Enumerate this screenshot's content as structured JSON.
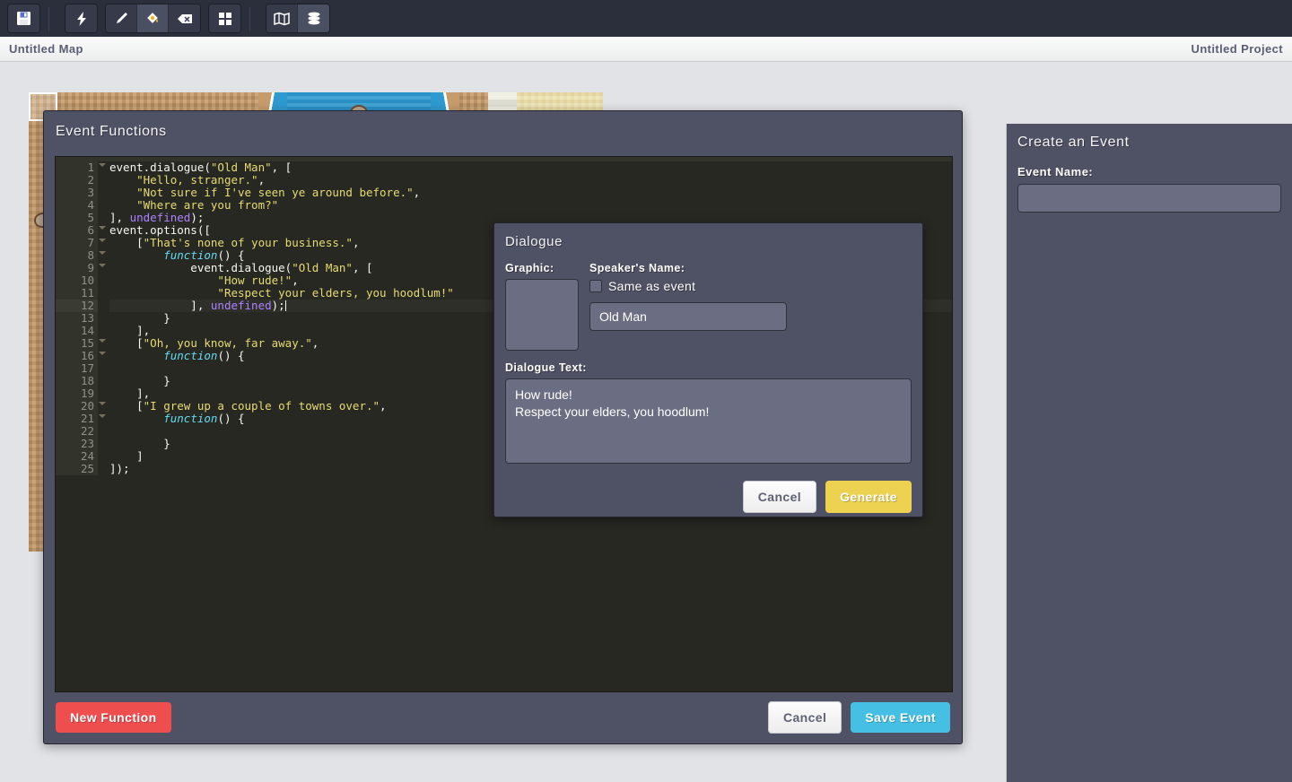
{
  "toolbar": {
    "groups": [
      {
        "name": "file",
        "buttons": [
          {
            "icon": "save-icon",
            "label": "Save",
            "active": false
          }
        ]
      },
      {
        "name": "tools-primary",
        "buttons": [
          {
            "icon": "lightning-icon",
            "label": "Events",
            "active": false
          }
        ]
      },
      {
        "name": "tools-draw",
        "buttons": [
          {
            "icon": "brush-icon",
            "label": "Brush",
            "active": false
          },
          {
            "icon": "bucket-icon",
            "label": "Fill Bucket",
            "active": true
          },
          {
            "icon": "eraser-icon",
            "label": "Eraser",
            "active": false
          }
        ]
      },
      {
        "name": "tools-grid",
        "buttons": [
          {
            "icon": "grid-icon",
            "label": "Grid",
            "active": false
          }
        ]
      },
      {
        "name": "views",
        "buttons": [
          {
            "icon": "map-icon",
            "label": "Map",
            "active": false
          },
          {
            "icon": "layers-icon",
            "label": "Layers",
            "active": true
          }
        ]
      }
    ]
  },
  "titlebar": {
    "map_title": "Untitled Map",
    "project_title": "Untitled Project"
  },
  "sidebar": {
    "heading": "Create an Event",
    "event_name_label": "Event Name:",
    "event_name_value": "",
    "event_name_placeholder": ""
  },
  "event_panel": {
    "heading": "Event Functions",
    "new_function_label": "New Function",
    "cancel_label": "Cancel",
    "save_label": "Save Event",
    "active_line": 12,
    "code_lines": [
      {
        "n": 1,
        "fold": true,
        "tokens": [
          {
            "t": "event.dialogue(",
            "c": "plain"
          },
          {
            "t": "\"Old Man\"",
            "c": "str"
          },
          {
            "t": ", [",
            "c": "plain"
          }
        ]
      },
      {
        "n": 2,
        "fold": false,
        "tokens": [
          {
            "t": "    ",
            "c": "plain"
          },
          {
            "t": "\"Hello, stranger.\"",
            "c": "str"
          },
          {
            "t": ",",
            "c": "plain"
          }
        ]
      },
      {
        "n": 3,
        "fold": false,
        "tokens": [
          {
            "t": "    ",
            "c": "plain"
          },
          {
            "t": "\"Not sure if I've seen ye around before.\"",
            "c": "str"
          },
          {
            "t": ",",
            "c": "plain"
          }
        ]
      },
      {
        "n": 4,
        "fold": false,
        "tokens": [
          {
            "t": "    ",
            "c": "plain"
          },
          {
            "t": "\"Where are you from?\"",
            "c": "str"
          }
        ]
      },
      {
        "n": 5,
        "fold": false,
        "tokens": [
          {
            "t": "], ",
            "c": "plain"
          },
          {
            "t": "undefined",
            "c": "undef"
          },
          {
            "t": ");",
            "c": "plain"
          }
        ]
      },
      {
        "n": 6,
        "fold": true,
        "tokens": [
          {
            "t": "event.options([",
            "c": "plain"
          }
        ]
      },
      {
        "n": 7,
        "fold": true,
        "tokens": [
          {
            "t": "    [",
            "c": "plain"
          },
          {
            "t": "\"That's none of your business.\"",
            "c": "str"
          },
          {
            "t": ",",
            "c": "plain"
          }
        ]
      },
      {
        "n": 8,
        "fold": true,
        "tokens": [
          {
            "t": "        ",
            "c": "plain"
          },
          {
            "t": "function",
            "c": "fn"
          },
          {
            "t": "() {",
            "c": "plain"
          }
        ]
      },
      {
        "n": 9,
        "fold": true,
        "tokens": [
          {
            "t": "            event.dialogue(",
            "c": "plain"
          },
          {
            "t": "\"Old Man\"",
            "c": "str"
          },
          {
            "t": ", [",
            "c": "plain"
          }
        ]
      },
      {
        "n": 10,
        "fold": false,
        "tokens": [
          {
            "t": "                ",
            "c": "plain"
          },
          {
            "t": "\"How rude!\"",
            "c": "str"
          },
          {
            "t": ",",
            "c": "plain"
          }
        ]
      },
      {
        "n": 11,
        "fold": false,
        "tokens": [
          {
            "t": "                ",
            "c": "plain"
          },
          {
            "t": "\"Respect your elders, you hoodlum!\"",
            "c": "str"
          }
        ]
      },
      {
        "n": 12,
        "fold": false,
        "caret": true,
        "tokens": [
          {
            "t": "            ], ",
            "c": "plain"
          },
          {
            "t": "undefined",
            "c": "undef"
          },
          {
            "t": ");",
            "c": "plain"
          }
        ]
      },
      {
        "n": 13,
        "fold": false,
        "tokens": [
          {
            "t": "        }",
            "c": "plain"
          }
        ]
      },
      {
        "n": 14,
        "fold": false,
        "tokens": [
          {
            "t": "    ],",
            "c": "plain"
          }
        ]
      },
      {
        "n": 15,
        "fold": true,
        "tokens": [
          {
            "t": "    [",
            "c": "plain"
          },
          {
            "t": "\"Oh, you know, far away.\"",
            "c": "str"
          },
          {
            "t": ",",
            "c": "plain"
          }
        ]
      },
      {
        "n": 16,
        "fold": true,
        "tokens": [
          {
            "t": "        ",
            "c": "plain"
          },
          {
            "t": "function",
            "c": "fn"
          },
          {
            "t": "() {",
            "c": "plain"
          }
        ]
      },
      {
        "n": 17,
        "fold": false,
        "tokens": [
          {
            "t": "",
            "c": "plain"
          }
        ]
      },
      {
        "n": 18,
        "fold": false,
        "tokens": [
          {
            "t": "        }",
            "c": "plain"
          }
        ]
      },
      {
        "n": 19,
        "fold": false,
        "tokens": [
          {
            "t": "    ],",
            "c": "plain"
          }
        ]
      },
      {
        "n": 20,
        "fold": true,
        "tokens": [
          {
            "t": "    [",
            "c": "plain"
          },
          {
            "t": "\"I grew up a couple of towns over.\"",
            "c": "str"
          },
          {
            "t": ",",
            "c": "plain"
          }
        ]
      },
      {
        "n": 21,
        "fold": true,
        "tokens": [
          {
            "t": "        ",
            "c": "plain"
          },
          {
            "t": "function",
            "c": "fn"
          },
          {
            "t": "() {",
            "c": "plain"
          }
        ]
      },
      {
        "n": 22,
        "fold": false,
        "tokens": [
          {
            "t": "",
            "c": "plain"
          }
        ]
      },
      {
        "n": 23,
        "fold": false,
        "tokens": [
          {
            "t": "        }",
            "c": "plain"
          }
        ]
      },
      {
        "n": 24,
        "fold": false,
        "tokens": [
          {
            "t": "    ]",
            "c": "plain"
          }
        ]
      },
      {
        "n": 25,
        "fold": false,
        "tokens": [
          {
            "t": "]);",
            "c": "plain"
          }
        ]
      }
    ]
  },
  "dialogue_modal": {
    "heading": "Dialogue",
    "graphic_label": "Graphic:",
    "speaker_label": "Speaker's Name:",
    "same_as_event_label": "Same as event",
    "same_as_event_checked": false,
    "speaker_value": "Old Man",
    "dialogue_text_label": "Dialogue Text:",
    "dialogue_text_value": "How rude!\nRespect your elders, you hoodlum!",
    "cancel_label": "Cancel",
    "generate_label": "Generate"
  },
  "colors": {
    "panel_bg": "#4f5265",
    "input_bg": "#6b6e82",
    "editor_bg": "#272822",
    "accent_red": "#ef4e4e",
    "accent_blue": "#46bfe4",
    "accent_yellow": "#edd252",
    "string_token": "#e6db74",
    "function_token": "#66d9ef",
    "undefined_token": "#ae81ff"
  }
}
